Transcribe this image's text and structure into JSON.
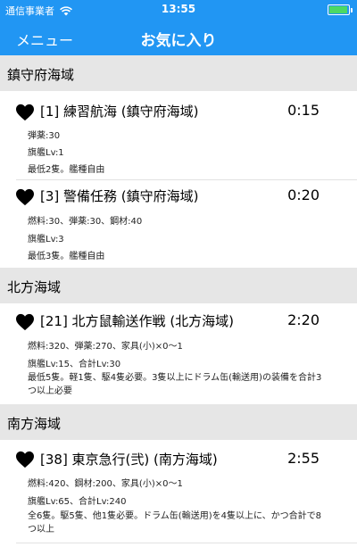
{
  "status_bar": {
    "carrier": "通信事業者",
    "wifi_icon": "wifi-icon",
    "time": "13:55",
    "battery_icon": "battery-icon"
  },
  "nav": {
    "menu_label": "メニュー",
    "title": "お気に入り"
  },
  "colors": {
    "accent": "#2196f3",
    "section_bg": "#e6e6e6",
    "battery": "#4cd964"
  },
  "sections": [
    {
      "header": "鎮守府海域",
      "items": [
        {
          "icon": "heart-icon",
          "title": "[1] 練習航海 (鎮守府海域)",
          "time": "0:15",
          "lines": [
            "弾薬:30",
            "旗艦Lv:1",
            "最低2隻。艦種自由"
          ]
        },
        {
          "icon": "heart-icon",
          "title": "[3] 警備任務 (鎮守府海域)",
          "time": "0:20",
          "lines": [
            "燃料:30、弾薬:30、鋼材:40",
            "旗艦Lv:3",
            "最低3隻。艦種自由"
          ]
        }
      ]
    },
    {
      "header": "北方海域",
      "items": [
        {
          "icon": "heart-icon",
          "title": "[21] 北方鼠輸送作戦 (北方海域)",
          "time": "2:20",
          "lines": [
            "燃料:320、弾薬:270、家具(小)×0〜1",
            "旗艦Lv:15、合計Lv:30",
            "最低5隻。軽1隻、駆4隻必要。3隻以上にドラム缶(輸送用)の装備を合計3つ以上必要"
          ]
        }
      ]
    },
    {
      "header": "南方海域",
      "items": [
        {
          "icon": "heart-icon",
          "title": "[38] 東京急行(弐) (南方海域)",
          "time": "2:55",
          "lines": [
            "燃料:420、鋼材:200、家具(小)×0〜1",
            "旗艦Lv:65、合計Lv:240",
            "全6隻。駆5隻、他1隻必要。ドラム缶(輸送用)を4隻以上に、かつ合計で8つ以上"
          ]
        }
      ]
    }
  ]
}
